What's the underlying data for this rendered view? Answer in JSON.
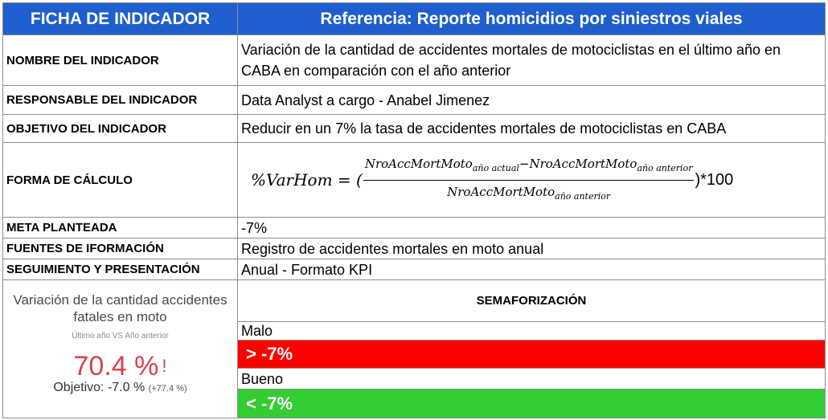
{
  "header": {
    "left": "FICHA DE INDICADOR",
    "right": "Referencia: Reporte homicidios por siniestros viales"
  },
  "rows": {
    "nombre": {
      "label": "NOMBRE DEL INDICADOR",
      "value_line1": "Variación de la cantidad de accidentes mortales de motociclistas en el último año en",
      "value_line2": "CABA en comparación con el año anterior"
    },
    "responsable": {
      "label": "RESPONSABLE DEL INDICADOR",
      "value": "Data Analyst a cargo - Anabel Jimenez"
    },
    "objetivo": {
      "label": "OBJETIVO DEL INDICADOR",
      "value": "Reducir en un 7% la tasa de accidentes mortales de motociclistas en CABA"
    },
    "calculo": {
      "label": "FORMA DE CÁLCULO",
      "lhs": "%VarHom = (",
      "num_a": "NroAccMortMoto",
      "sub_a": "año actual",
      "minus": "−",
      "num_b": "NroAccMortMoto",
      "sub_b": "año anterior",
      "den": "NroAccMortMoto",
      "sub_den": "año anterior",
      "rhs": ")*100"
    },
    "meta": {
      "label": "META PLANTEADA",
      "value": "-7%"
    },
    "fuentes": {
      "label": "FUENTES DE IFORMACIÓN",
      "value": "Registro de accidentes mortales en moto anual"
    },
    "seguimiento": {
      "label": "SEGUIMIENTO Y PRESENTACIÓN",
      "value": "Anual - Formato KPI"
    }
  },
  "kpi": {
    "title_line1": "Variación de la cantidad accidentes",
    "title_line2": "fatales en moto",
    "subtitle": "Último año VS Año anterior",
    "value": "70.4 %",
    "alert": "!",
    "target_label": "Objetivo: -7.0 %",
    "target_delta": "(+77.4 %)",
    "value_color": "#d9434a"
  },
  "semaforizacion": {
    "title": "SEMAFORIZACIÓN",
    "bad_label": "Malo",
    "bad_value": "> -7%",
    "bad_color": "#ff0000",
    "good_label": "Bueno",
    "good_value": "< -7%",
    "good_color": "#33cc33"
  }
}
